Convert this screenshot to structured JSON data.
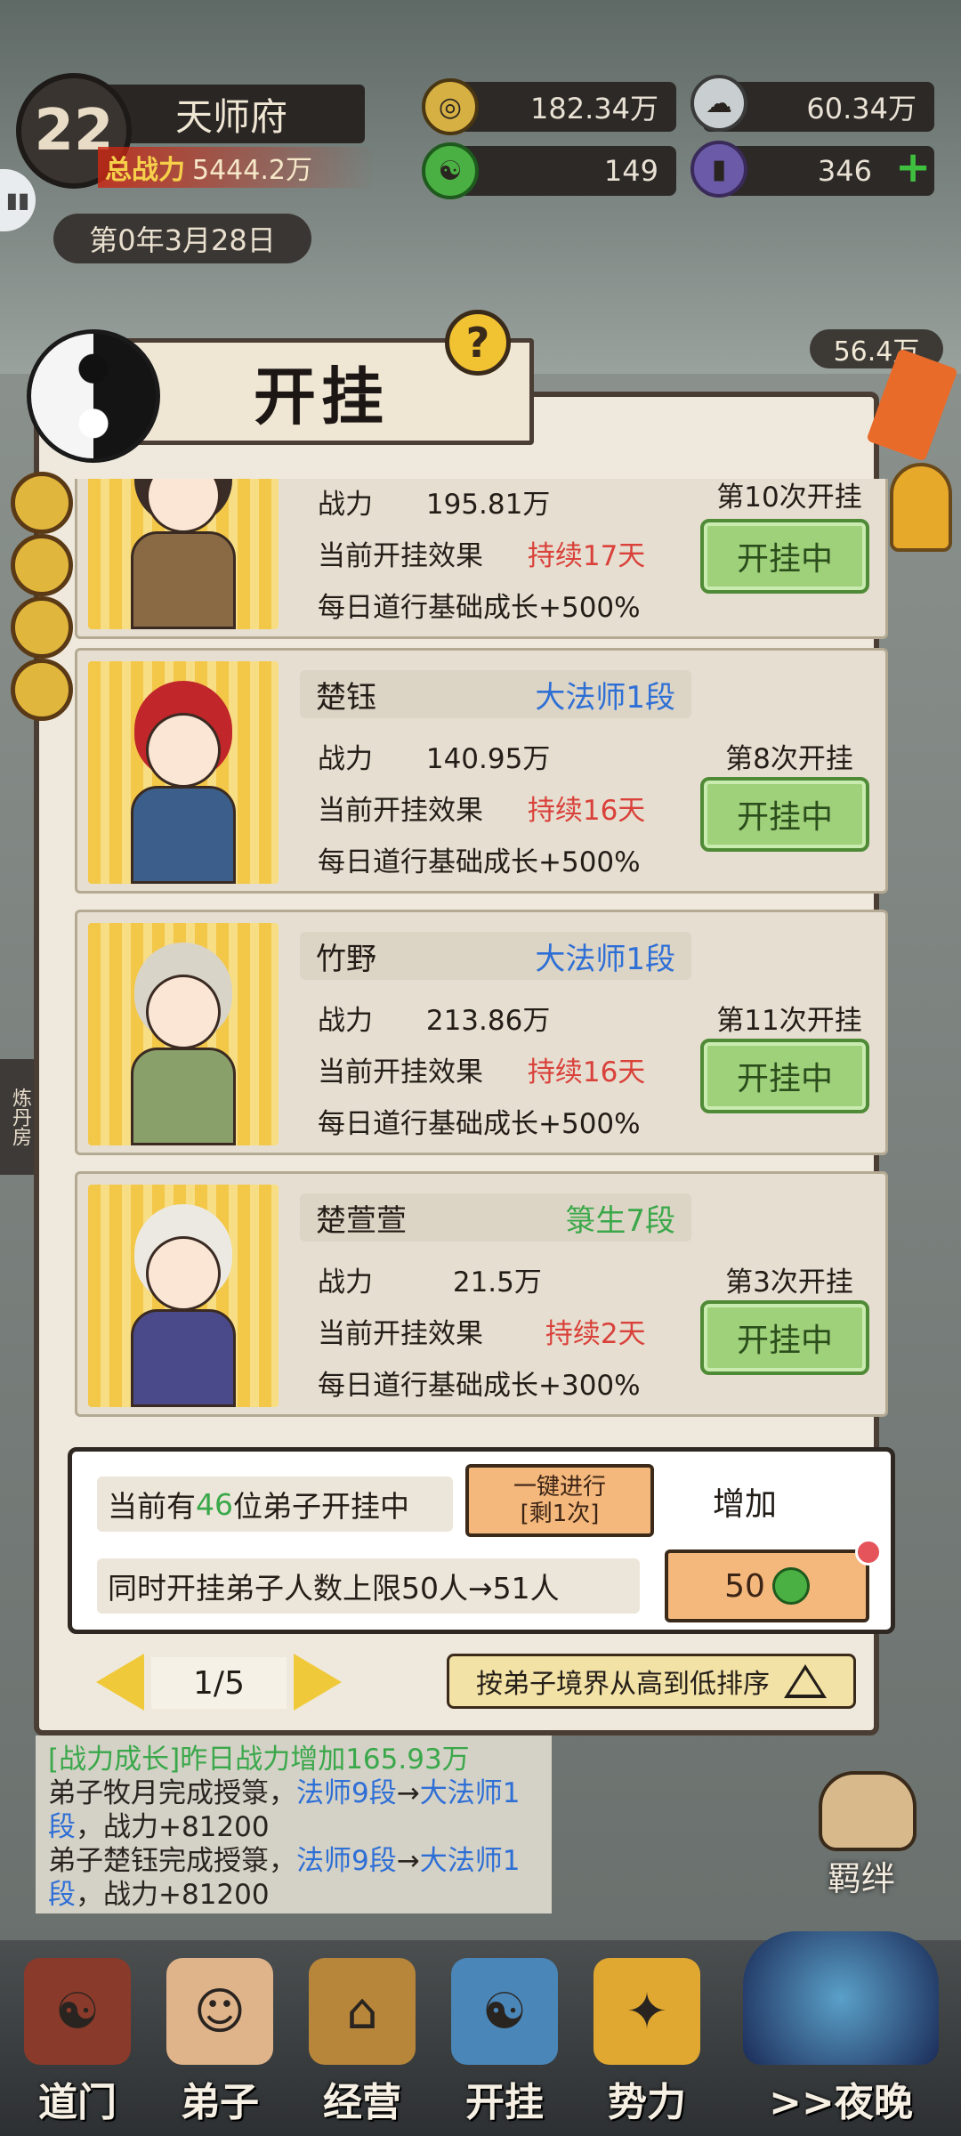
{
  "hud": {
    "level": "22",
    "house_name": "天师府",
    "total_power_label": "总战力",
    "total_power_value": "5444.2万",
    "date": "第0年3月28日",
    "coins": "182.34万",
    "incense": "60.34万",
    "jade": "149",
    "tokens": "346",
    "plus": "+",
    "side_money": "56.4万"
  },
  "side_label": "炼丹房",
  "panel": {
    "title": "开挂",
    "help": "?"
  },
  "disciples": [
    {
      "name": "",
      "rank": "",
      "power_label": "战力",
      "power": "195.81万",
      "effect_label": "当前开挂效果",
      "duration": "持续17天",
      "growth": "每日道行基础成长+500%",
      "count": "第10次开挂",
      "button": "开挂中"
    },
    {
      "name": "楚钰",
      "rank": "大法师1段",
      "power_label": "战力",
      "power": "140.95万",
      "effect_label": "当前开挂效果",
      "duration": "持续16天",
      "growth": "每日道行基础成长+500%",
      "count": "第8次开挂",
      "button": "开挂中"
    },
    {
      "name": "竹野",
      "rank": "大法师1段",
      "power_label": "战力",
      "power": "213.86万",
      "effect_label": "当前开挂效果",
      "duration": "持续16天",
      "growth": "每日道行基础成长+500%",
      "count": "第11次开挂",
      "button": "开挂中"
    },
    {
      "name": "楚萱萱",
      "rank": "箓生7段",
      "power_label": "战力",
      "power": "21.5万",
      "effect_label": "当前开挂效果",
      "duration": "持续2天",
      "growth": "每日道行基础成长+300%",
      "count": "第3次开挂",
      "button": "开挂中"
    }
  ],
  "summary": {
    "prefix": "当前有",
    "count": "46",
    "suffix": "位弟子开挂中",
    "onekey_line1": "一键进行",
    "onekey_line2": "[剩1次]",
    "add_label": "增加",
    "limit_text": "同时开挂弟子人数上限50人→51人",
    "cost": "50"
  },
  "pager": {
    "page": "1/5",
    "sort_label": "按弟子境界从高到低排序"
  },
  "log": {
    "l1_tag": "[战力成长]",
    "l1_text": "昨日战力增加165.93万",
    "l2_a": "弟子牧月完成授箓，",
    "l2_b": "法师9段",
    "l2_c": "→",
    "l2_d": "大法师1段",
    "l2_e": "，战力+81200",
    "l3_a": "弟子楚钰完成授箓，",
    "l3_b": "法师9段",
    "l3_c": "→",
    "l3_d": "大法师1段",
    "l3_e": "，战力+81200"
  },
  "bond_label": "羁绊",
  "nav": [
    {
      "label": "道门"
    },
    {
      "label": "弟子"
    },
    {
      "label": "经营"
    },
    {
      "label": "开挂"
    },
    {
      "label": "势力"
    },
    {
      "label": ">>夜晚"
    }
  ]
}
